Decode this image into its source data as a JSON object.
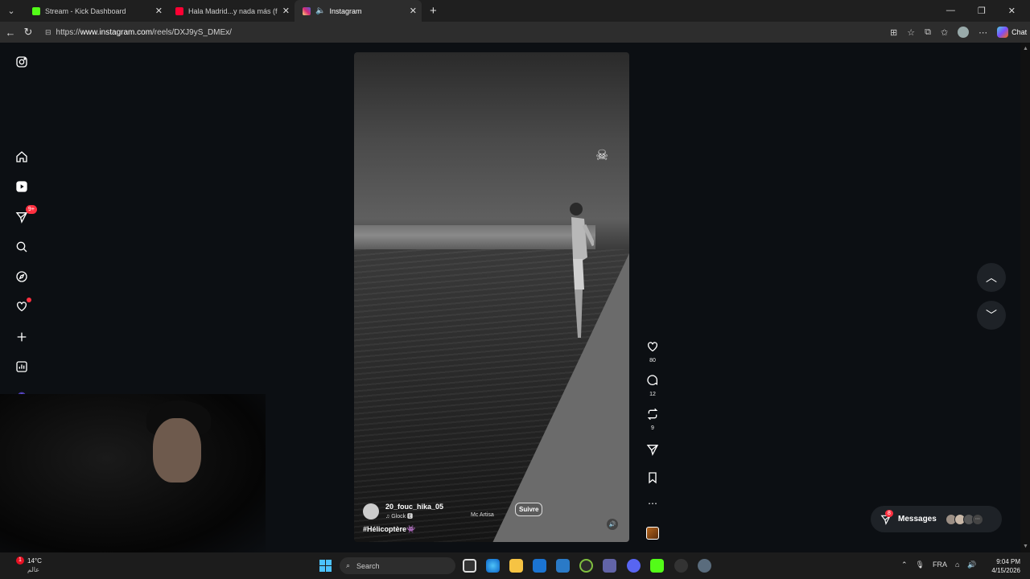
{
  "browser": {
    "tabs": [
      {
        "title": "Stream - Kick Dashboard",
        "favicon_color": "#53fc18",
        "active": false
      },
      {
        "title": "Hala Madrid...y nada más (feat. Re",
        "favicon_color": "#ff0033",
        "active": false
      },
      {
        "title": "Instagram",
        "favicon_color": "#e1306c",
        "active": true
      }
    ],
    "url_prefix": "https://",
    "url_host": "www.instagram.com",
    "url_path": "/reels/DXJ9yS_DMEx/",
    "chat_label": "Chat"
  },
  "sidebar": {
    "notifications_badge": "9+"
  },
  "reel": {
    "username": "20_fouc_hika_05",
    "music": "♫ Glock 🅴",
    "music_artist": "Mc Artisa",
    "follow_label": "Suivre",
    "caption": "#Hélicoptère👾"
  },
  "actions": {
    "likes": "80",
    "comments": "12",
    "reposts": "9"
  },
  "messages": {
    "label": "Messages",
    "badge": "8"
  },
  "taskbar": {
    "weather_badge": "1",
    "temperature": "14°C",
    "city": "عالم",
    "search_placeholder": "Search",
    "language": "FRA",
    "time": "9:04 PM",
    "date": "4/15/2026"
  },
  "colors": {
    "accent": "#ff3040",
    "page_bg": "#0c0f13"
  }
}
